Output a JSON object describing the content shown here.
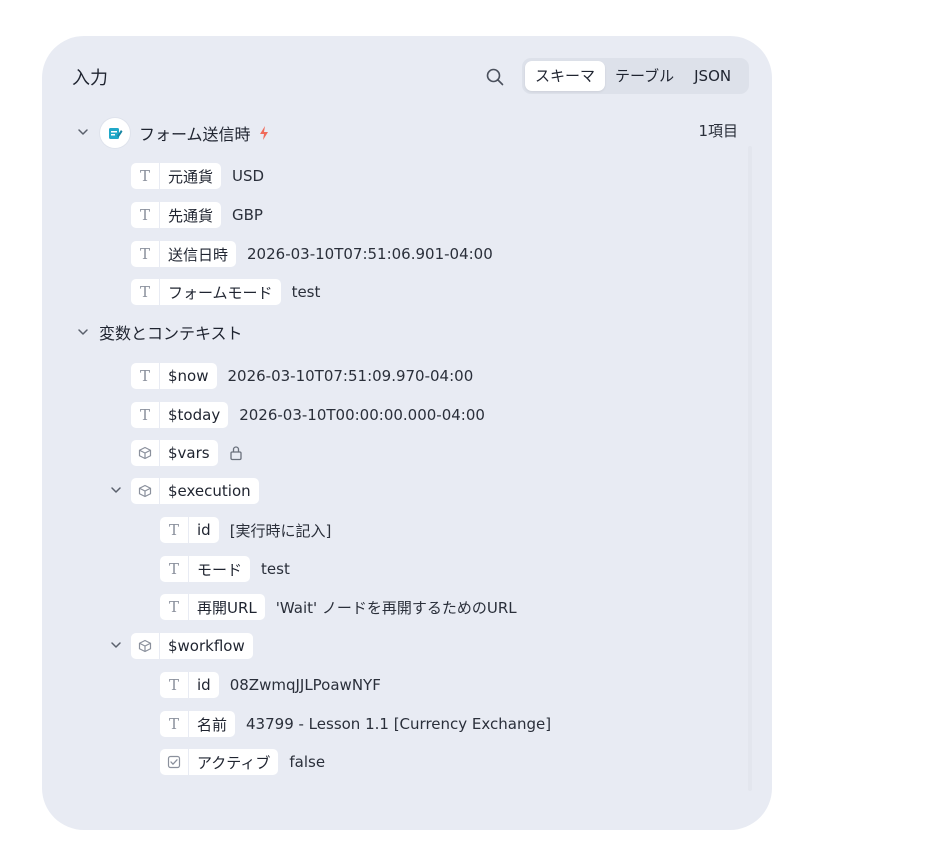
{
  "panel": {
    "title": "入力",
    "tabs": [
      {
        "label": "スキーマ",
        "active": true
      },
      {
        "label": "テーブル",
        "active": false
      },
      {
        "label": "JSON",
        "active": false
      }
    ]
  },
  "trigger": {
    "label": "フォーム送信時",
    "count": "1項目",
    "fields": [
      {
        "key": "元通貨",
        "value": "USD",
        "type": "text"
      },
      {
        "key": "先通貨",
        "value": "GBP",
        "type": "text"
      },
      {
        "key": "送信日時",
        "value": "2026-03-10T07:51:06.901-04:00",
        "type": "text"
      },
      {
        "key": "フォームモード",
        "value": "test",
        "type": "text"
      }
    ]
  },
  "context": {
    "label": "変数とコンテキスト",
    "now": {
      "key": "$now",
      "value": "2026-03-10T07:51:09.970-04:00"
    },
    "today": {
      "key": "$today",
      "value": "2026-03-10T00:00:00.000-04:00"
    },
    "vars": {
      "key": "$vars"
    },
    "execution": {
      "key": "$execution",
      "fields": [
        {
          "key": "id",
          "value": "[実行時に記入]"
        },
        {
          "key": "モード",
          "value": "test"
        },
        {
          "key": "再開URL",
          "value": "'Wait' ノードを再開するためのURL"
        }
      ]
    },
    "workflow": {
      "key": "$workflow",
      "fields": [
        {
          "key": "id",
          "value": "08ZwmqJJLPoawNYF"
        },
        {
          "key": "名前",
          "value": "43799 - Lesson 1.1 [Currency Exchange]"
        },
        {
          "key": "アクティブ",
          "value": "false"
        }
      ]
    }
  },
  "icons": {
    "text_type": "T",
    "accent_bolt": "#f06a5a",
    "node_icon_color": "#20a8c8"
  }
}
